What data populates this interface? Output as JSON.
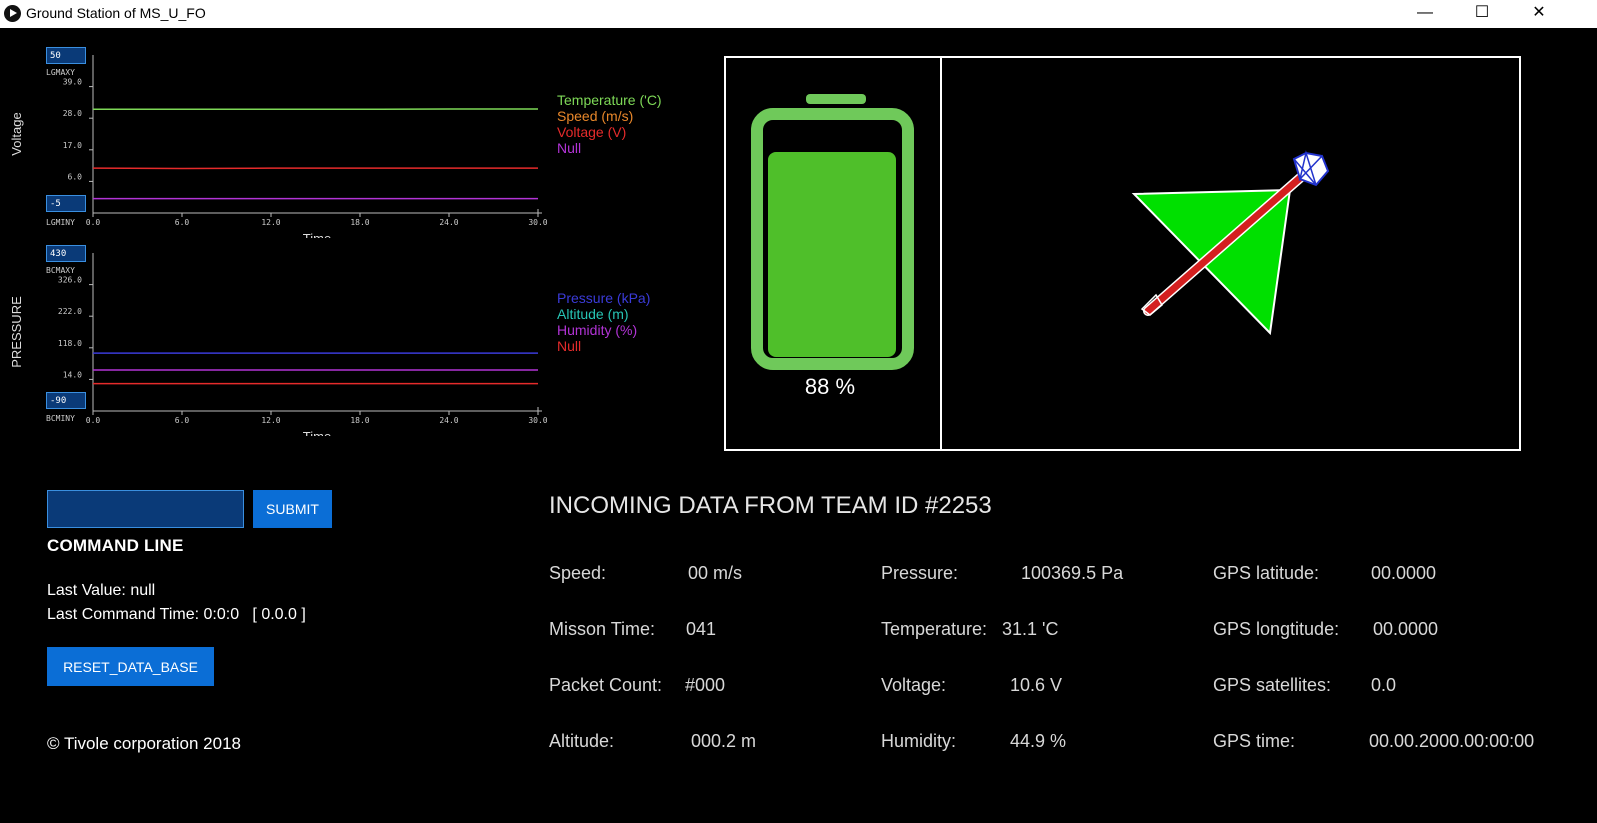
{
  "window": {
    "title": "Ground Station of MS_U_FO",
    "minimize": "—",
    "maximize": "☐",
    "close": "✕"
  },
  "chart_data": [
    {
      "type": "line",
      "ylabel": "Voltage",
      "xlabel": "Time",
      "x_ticks": [
        "0.0",
        "6.0",
        "12.0",
        "18.0",
        "24.0",
        "30.0"
      ],
      "y_ticks": [
        "39.0",
        "28.0",
        "17.0",
        "6.0"
      ],
      "ylim": [
        -5,
        50
      ],
      "xlim": [
        0,
        30
      ],
      "max_label": "LGMAXY",
      "min_label": "LGMINY",
      "max_value": "50",
      "min_value": "-5",
      "series": [
        {
          "name": "Temperature ('C)",
          "color": "#7ed957",
          "values": [
            31.1,
            31.1,
            31.1,
            31.1,
            31.2,
            31.2
          ]
        },
        {
          "name": "Speed (m/s)",
          "color": "#e8872a",
          "values": []
        },
        {
          "name": "Voltage (V)",
          "color": "#e52b2b",
          "values": [
            10.6,
            10.5,
            10.6,
            10.6,
            10.6,
            10.6
          ]
        },
        {
          "name": "Null",
          "color": "#b234d6",
          "values": [
            0,
            0,
            0,
            0,
            0,
            0
          ]
        }
      ]
    },
    {
      "type": "line",
      "ylabel": "PRESSURE",
      "xlabel": "Time",
      "x_ticks": [
        "0.0",
        "6.0",
        "12.0",
        "18.0",
        "24.0",
        "30.0"
      ],
      "y_ticks": [
        "326.0",
        "222.0",
        "118.0",
        "14.0"
      ],
      "ylim": [
        -90,
        430
      ],
      "xlim": [
        0,
        30
      ],
      "max_label": "BCMAXY",
      "min_label": "BCMINY",
      "max_value": "430",
      "min_value": "-90",
      "series": [
        {
          "name": "Pressure (kPa)",
          "color": "#3b3bd9",
          "values": [
            100.4,
            100.4,
            100.4,
            100.4,
            100.4,
            100.4
          ]
        },
        {
          "name": "Altitude (m)",
          "color": "#27c4b4",
          "values": []
        },
        {
          "name": "Humidity (%)",
          "color": "#b234d6",
          "values": [
            44.9,
            44.9,
            44.9,
            44.9,
            44.9,
            44.9
          ]
        },
        {
          "name": "Null",
          "color": "#e52b2b",
          "values": [
            0,
            0,
            0,
            0,
            0,
            0
          ]
        }
      ]
    }
  ],
  "battery": {
    "percent_label": "88 %",
    "level": 0.88,
    "color": "#4fbf2a"
  },
  "command": {
    "input_value": "",
    "submit_label": "SUBMIT",
    "heading": "COMMAND LINE",
    "last_value": "Last Value: null",
    "last_time": "Last Command Time: 0:0:0   [ 0.0.0 ]",
    "reset_label": "RESET_DATA_BASE"
  },
  "footer": {
    "copyright": "© Tivole corporation 2018"
  },
  "incoming": {
    "heading": "INCOMING DATA FROM TEAM ID #2253",
    "col1": [
      {
        "label": "Speed:",
        "value": "00 m/s"
      },
      {
        "label": "Misson Time:",
        "value": "041"
      },
      {
        "label": "Packet Count:",
        "value": "#000"
      },
      {
        "label": "Altitude:",
        "value": "000.2 m"
      }
    ],
    "col2": [
      {
        "label": "Pressure:",
        "value": "100369.5 Pa"
      },
      {
        "label": "Temperature:",
        "value": "31.1 'C"
      },
      {
        "label": "Voltage:",
        "value": "10.6 V"
      },
      {
        "label": "Humidity:",
        "value": "44.9 %"
      }
    ],
    "col3": [
      {
        "label": "GPS latitude:",
        "value": "00.0000"
      },
      {
        "label": "GPS longtitude:",
        "value": "00.0000"
      },
      {
        "label": "GPS satellites:",
        "value": "0.0"
      },
      {
        "label": "GPS time:",
        "value": "00.00.2000.00:00:00"
      }
    ]
  }
}
